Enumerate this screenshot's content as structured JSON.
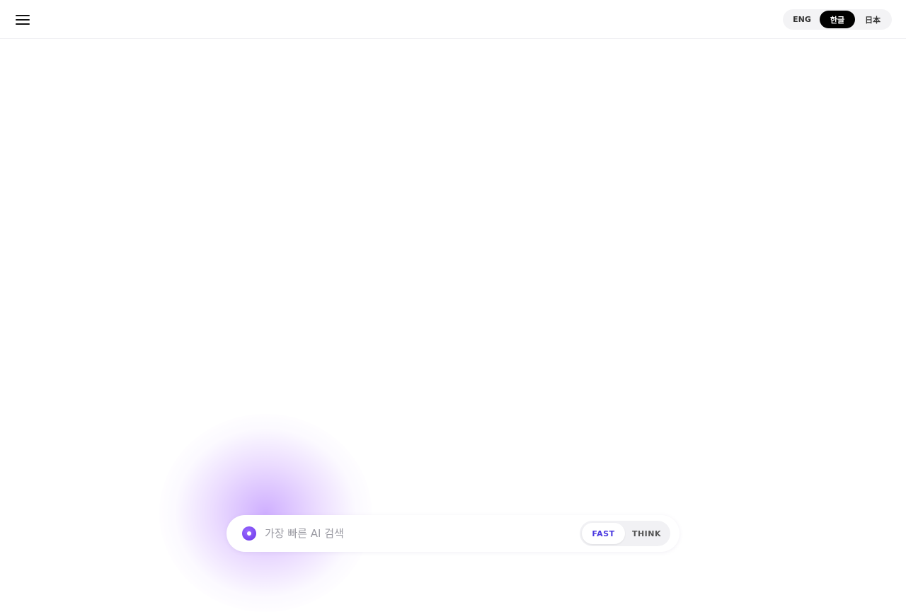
{
  "header": {
    "languages": [
      {
        "label": "ENG",
        "active": false
      },
      {
        "label": "한글",
        "active": true
      },
      {
        "label": "日本",
        "active": false
      }
    ]
  },
  "search": {
    "placeholder": "가장 빠른 AI 검색",
    "value": "",
    "modes": [
      {
        "label": "FAST",
        "active": true
      },
      {
        "label": "THINK",
        "active": false
      }
    ]
  },
  "colors": {
    "accent": "#4b3ae0",
    "orb": "#6a35e8",
    "active_lang_bg": "#000000",
    "glow": "#a86eff"
  },
  "icons": {
    "menu": "hamburger-menu-icon",
    "search_orb": "ai-orb-icon"
  }
}
